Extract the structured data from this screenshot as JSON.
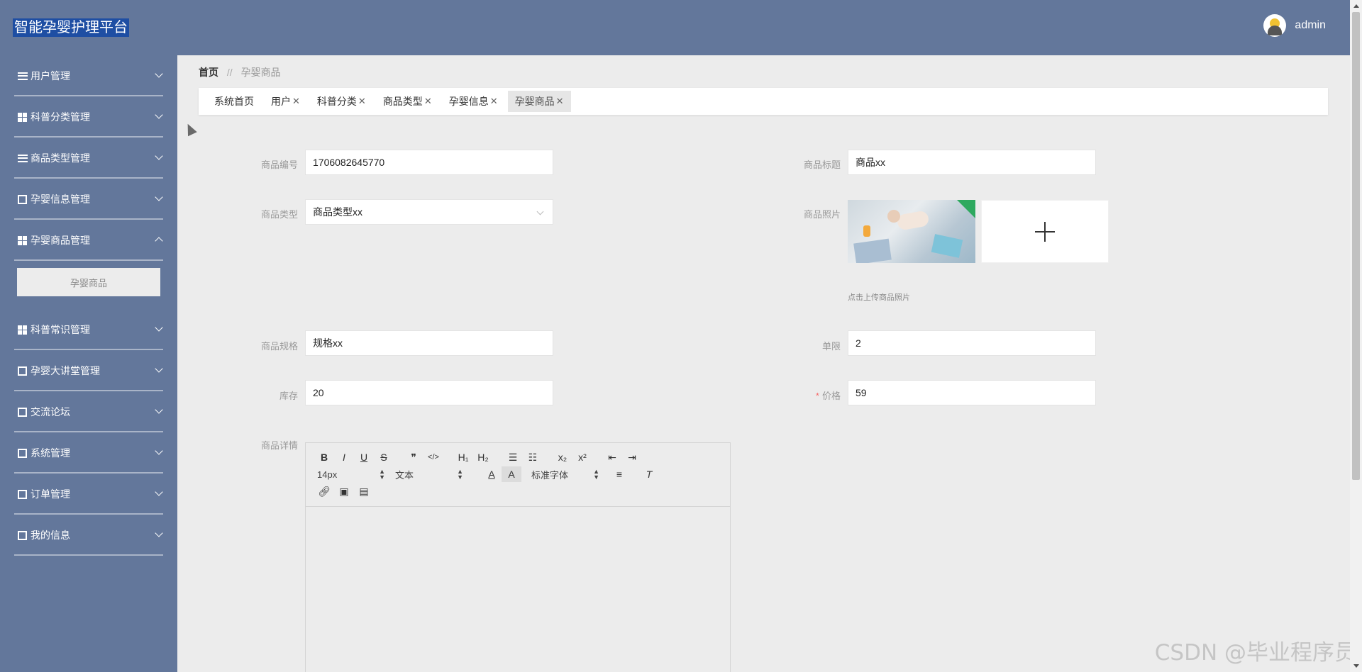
{
  "header": {
    "app_title": "智能孕婴护理平台",
    "username": "admin"
  },
  "sidebar": {
    "items": [
      {
        "label": "用户管理",
        "icon": "list-icon",
        "expanded": false
      },
      {
        "label": "科普分类管理",
        "icon": "grid-icon",
        "expanded": false
      },
      {
        "label": "商品类型管理",
        "icon": "list-icon",
        "expanded": false
      },
      {
        "label": "孕婴信息管理",
        "icon": "columns-icon",
        "expanded": false
      },
      {
        "label": "孕婴商品管理",
        "icon": "grid-icon",
        "expanded": true,
        "sub": [
          "孕婴商品"
        ]
      },
      {
        "label": "科普常识管理",
        "icon": "grid-icon",
        "expanded": false
      },
      {
        "label": "孕婴大讲堂管理",
        "icon": "clipboard-icon",
        "expanded": false
      },
      {
        "label": "交流论坛",
        "icon": "thumbs-up-icon",
        "expanded": false
      },
      {
        "label": "系统管理",
        "icon": "briefcase-icon",
        "expanded": false
      },
      {
        "label": "订单管理",
        "icon": "file-icon",
        "expanded": false
      },
      {
        "label": "我的信息",
        "icon": "credit-card-icon",
        "expanded": false
      }
    ]
  },
  "breadcrumb": {
    "home": "首页",
    "separator": "//",
    "current": "孕婴商品"
  },
  "tabs": [
    {
      "label": "系统首页",
      "closable": false,
      "active": false
    },
    {
      "label": "用户",
      "closable": true,
      "active": false
    },
    {
      "label": "科普分类",
      "closable": true,
      "active": false
    },
    {
      "label": "商品类型",
      "closable": true,
      "active": false
    },
    {
      "label": "孕婴信息",
      "closable": true,
      "active": false
    },
    {
      "label": "孕婴商品",
      "closable": true,
      "active": true
    }
  ],
  "form": {
    "product_no": {
      "label": "商品编号",
      "value": "1706082645770"
    },
    "product_title": {
      "label": "商品标题",
      "value": "商品xx"
    },
    "product_type": {
      "label": "商品类型",
      "value": "商品类型xx"
    },
    "product_photo": {
      "label": "商品照片",
      "hint": "点击上传商品照片"
    },
    "product_spec": {
      "label": "商品规格",
      "value": "规格xx"
    },
    "limit": {
      "label": "单限",
      "value": "2"
    },
    "stock": {
      "label": "库存",
      "value": "20"
    },
    "price": {
      "label": "价格",
      "value": "59",
      "required_mark": "*"
    },
    "detail": {
      "label": "商品详情"
    }
  },
  "editor": {
    "font_size": "14px",
    "format": "文本",
    "font_family": "标准字体",
    "buttons_row1": [
      "B",
      "I",
      "U",
      "S",
      "❞",
      "</>",
      "H₁",
      "H₂",
      "ordered-list",
      "bullet-list",
      "x₂",
      "x²",
      "outdent",
      "indent"
    ]
  },
  "watermark": "CSDN @毕业程序员",
  "colors": {
    "header_bg": "#63779b",
    "sidebar_bg": "#63779b",
    "content_bg": "#ececec",
    "title_highlight": "#1e4ea3",
    "required": "#f56c6c"
  }
}
